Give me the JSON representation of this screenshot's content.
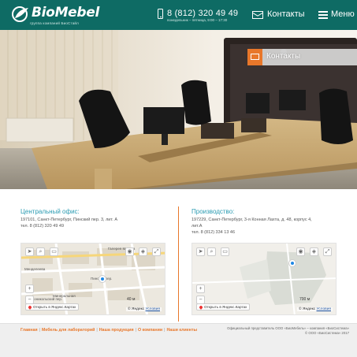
{
  "header": {
    "logo_text": "BioMebel",
    "logo_subtitle": "группа компаний БиоСтайл",
    "phone": "8 (812) 320 49 49",
    "phone_hours": "понедельник – пятница, 9:00 – 17:30",
    "contacts_label": "Контакты",
    "menu_label": "Меню"
  },
  "hero": {
    "badge_label": "Контакты"
  },
  "offices": {
    "central": {
      "title": "Центральный офис:",
      "address_line1": "197101, Санкт-Петербург, Пинский пер. 3, лит. А",
      "phone_line": "тел. 8 (812) 320 49 49"
    },
    "production": {
      "title": "Производство:",
      "address_line1": "197229, Санкт-Петербург, 3-я Конная Лахта, д. 48, корпус 4,",
      "address_line2": "лит.А",
      "phone_line": "тел. 8 (812) 334 13 46"
    }
  },
  "map_left": {
    "open_label": "Открыть в Яндекс.Картах",
    "scale_label": "40 м",
    "copyright": "© Яндекс",
    "terms": "Условия",
    "street_labels": [
      "Галерея Мотора",
      "Пинский пер.",
      "Менделеева",
      "Минеральная",
      "Новоникольский пер."
    ]
  },
  "map_right": {
    "open_label": "Открыть в Яндекс.Картах",
    "scale_label": "700 м",
    "copyright": "© Яндекс",
    "terms": "Условия"
  },
  "footer": {
    "nav": [
      "Главная",
      "Мебель для лабораторий",
      "Наша продукция",
      "О компании",
      "Наши клиенты"
    ],
    "right_line1": "Официальный представитель ООО «БиоМебель» – компания «БиоСистема»",
    "right_line2": "© ООО «БиоСистема» 2017"
  },
  "colors": {
    "header_bg": "#0e6b64",
    "accent_orange": "#e8772a",
    "title_blue": "#2a9bb2"
  }
}
